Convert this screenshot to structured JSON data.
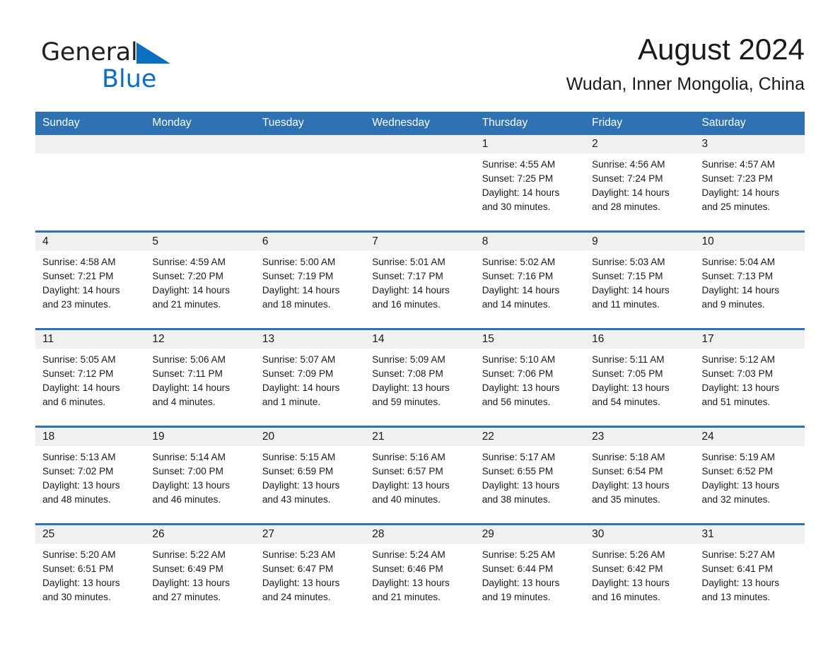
{
  "brand": {
    "word1": "General",
    "word2": "Blue",
    "flag_icon": "blue-triangle-flag-icon",
    "accent_color": "#0b6fc1"
  },
  "header": {
    "month_title": "August 2024",
    "location": "Wudan, Inner Mongolia, China"
  },
  "theme": {
    "header_blue": "#2f72b4",
    "daynum_gray": "#f0f0f0",
    "text_dark": "#1a1a1a"
  },
  "calendar": {
    "weekday_headers": [
      "Sunday",
      "Monday",
      "Tuesday",
      "Wednesday",
      "Thursday",
      "Friday",
      "Saturday"
    ],
    "weeks": [
      [
        {
          "day": "",
          "sunrise": "",
          "sunset": "",
          "daylight_line1": "",
          "daylight_line2": ""
        },
        {
          "day": "",
          "sunrise": "",
          "sunset": "",
          "daylight_line1": "",
          "daylight_line2": ""
        },
        {
          "day": "",
          "sunrise": "",
          "sunset": "",
          "daylight_line1": "",
          "daylight_line2": ""
        },
        {
          "day": "",
          "sunrise": "",
          "sunset": "",
          "daylight_line1": "",
          "daylight_line2": ""
        },
        {
          "day": "1",
          "sunrise": "Sunrise: 4:55 AM",
          "sunset": "Sunset: 7:25 PM",
          "daylight_line1": "Daylight: 14 hours",
          "daylight_line2": "and 30 minutes."
        },
        {
          "day": "2",
          "sunrise": "Sunrise: 4:56 AM",
          "sunset": "Sunset: 7:24 PM",
          "daylight_line1": "Daylight: 14 hours",
          "daylight_line2": "and 28 minutes."
        },
        {
          "day": "3",
          "sunrise": "Sunrise: 4:57 AM",
          "sunset": "Sunset: 7:23 PM",
          "daylight_line1": "Daylight: 14 hours",
          "daylight_line2": "and 25 minutes."
        }
      ],
      [
        {
          "day": "4",
          "sunrise": "Sunrise: 4:58 AM",
          "sunset": "Sunset: 7:21 PM",
          "daylight_line1": "Daylight: 14 hours",
          "daylight_line2": "and 23 minutes."
        },
        {
          "day": "5",
          "sunrise": "Sunrise: 4:59 AM",
          "sunset": "Sunset: 7:20 PM",
          "daylight_line1": "Daylight: 14 hours",
          "daylight_line2": "and 21 minutes."
        },
        {
          "day": "6",
          "sunrise": "Sunrise: 5:00 AM",
          "sunset": "Sunset: 7:19 PM",
          "daylight_line1": "Daylight: 14 hours",
          "daylight_line2": "and 18 minutes."
        },
        {
          "day": "7",
          "sunrise": "Sunrise: 5:01 AM",
          "sunset": "Sunset: 7:17 PM",
          "daylight_line1": "Daylight: 14 hours",
          "daylight_line2": "and 16 minutes."
        },
        {
          "day": "8",
          "sunrise": "Sunrise: 5:02 AM",
          "sunset": "Sunset: 7:16 PM",
          "daylight_line1": "Daylight: 14 hours",
          "daylight_line2": "and 14 minutes."
        },
        {
          "day": "9",
          "sunrise": "Sunrise: 5:03 AM",
          "sunset": "Sunset: 7:15 PM",
          "daylight_line1": "Daylight: 14 hours",
          "daylight_line2": "and 11 minutes."
        },
        {
          "day": "10",
          "sunrise": "Sunrise: 5:04 AM",
          "sunset": "Sunset: 7:13 PM",
          "daylight_line1": "Daylight: 14 hours",
          "daylight_line2": "and 9 minutes."
        }
      ],
      [
        {
          "day": "11",
          "sunrise": "Sunrise: 5:05 AM",
          "sunset": "Sunset: 7:12 PM",
          "daylight_line1": "Daylight: 14 hours",
          "daylight_line2": "and 6 minutes."
        },
        {
          "day": "12",
          "sunrise": "Sunrise: 5:06 AM",
          "sunset": "Sunset: 7:11 PM",
          "daylight_line1": "Daylight: 14 hours",
          "daylight_line2": "and 4 minutes."
        },
        {
          "day": "13",
          "sunrise": "Sunrise: 5:07 AM",
          "sunset": "Sunset: 7:09 PM",
          "daylight_line1": "Daylight: 14 hours",
          "daylight_line2": "and 1 minute."
        },
        {
          "day": "14",
          "sunrise": "Sunrise: 5:09 AM",
          "sunset": "Sunset: 7:08 PM",
          "daylight_line1": "Daylight: 13 hours",
          "daylight_line2": "and 59 minutes."
        },
        {
          "day": "15",
          "sunrise": "Sunrise: 5:10 AM",
          "sunset": "Sunset: 7:06 PM",
          "daylight_line1": "Daylight: 13 hours",
          "daylight_line2": "and 56 minutes."
        },
        {
          "day": "16",
          "sunrise": "Sunrise: 5:11 AM",
          "sunset": "Sunset: 7:05 PM",
          "daylight_line1": "Daylight: 13 hours",
          "daylight_line2": "and 54 minutes."
        },
        {
          "day": "17",
          "sunrise": "Sunrise: 5:12 AM",
          "sunset": "Sunset: 7:03 PM",
          "daylight_line1": "Daylight: 13 hours",
          "daylight_line2": "and 51 minutes."
        }
      ],
      [
        {
          "day": "18",
          "sunrise": "Sunrise: 5:13 AM",
          "sunset": "Sunset: 7:02 PM",
          "daylight_line1": "Daylight: 13 hours",
          "daylight_line2": "and 48 minutes."
        },
        {
          "day": "19",
          "sunrise": "Sunrise: 5:14 AM",
          "sunset": "Sunset: 7:00 PM",
          "daylight_line1": "Daylight: 13 hours",
          "daylight_line2": "and 46 minutes."
        },
        {
          "day": "20",
          "sunrise": "Sunrise: 5:15 AM",
          "sunset": "Sunset: 6:59 PM",
          "daylight_line1": "Daylight: 13 hours",
          "daylight_line2": "and 43 minutes."
        },
        {
          "day": "21",
          "sunrise": "Sunrise: 5:16 AM",
          "sunset": "Sunset: 6:57 PM",
          "daylight_line1": "Daylight: 13 hours",
          "daylight_line2": "and 40 minutes."
        },
        {
          "day": "22",
          "sunrise": "Sunrise: 5:17 AM",
          "sunset": "Sunset: 6:55 PM",
          "daylight_line1": "Daylight: 13 hours",
          "daylight_line2": "and 38 minutes."
        },
        {
          "day": "23",
          "sunrise": "Sunrise: 5:18 AM",
          "sunset": "Sunset: 6:54 PM",
          "daylight_line1": "Daylight: 13 hours",
          "daylight_line2": "and 35 minutes."
        },
        {
          "day": "24",
          "sunrise": "Sunrise: 5:19 AM",
          "sunset": "Sunset: 6:52 PM",
          "daylight_line1": "Daylight: 13 hours",
          "daylight_line2": "and 32 minutes."
        }
      ],
      [
        {
          "day": "25",
          "sunrise": "Sunrise: 5:20 AM",
          "sunset": "Sunset: 6:51 PM",
          "daylight_line1": "Daylight: 13 hours",
          "daylight_line2": "and 30 minutes."
        },
        {
          "day": "26",
          "sunrise": "Sunrise: 5:22 AM",
          "sunset": "Sunset: 6:49 PM",
          "daylight_line1": "Daylight: 13 hours",
          "daylight_line2": "and 27 minutes."
        },
        {
          "day": "27",
          "sunrise": "Sunrise: 5:23 AM",
          "sunset": "Sunset: 6:47 PM",
          "daylight_line1": "Daylight: 13 hours",
          "daylight_line2": "and 24 minutes."
        },
        {
          "day": "28",
          "sunrise": "Sunrise: 5:24 AM",
          "sunset": "Sunset: 6:46 PM",
          "daylight_line1": "Daylight: 13 hours",
          "daylight_line2": "and 21 minutes."
        },
        {
          "day": "29",
          "sunrise": "Sunrise: 5:25 AM",
          "sunset": "Sunset: 6:44 PM",
          "daylight_line1": "Daylight: 13 hours",
          "daylight_line2": "and 19 minutes."
        },
        {
          "day": "30",
          "sunrise": "Sunrise: 5:26 AM",
          "sunset": "Sunset: 6:42 PM",
          "daylight_line1": "Daylight: 13 hours",
          "daylight_line2": "and 16 minutes."
        },
        {
          "day": "31",
          "sunrise": "Sunrise: 5:27 AM",
          "sunset": "Sunset: 6:41 PM",
          "daylight_line1": "Daylight: 13 hours",
          "daylight_line2": "and 13 minutes."
        }
      ]
    ]
  }
}
